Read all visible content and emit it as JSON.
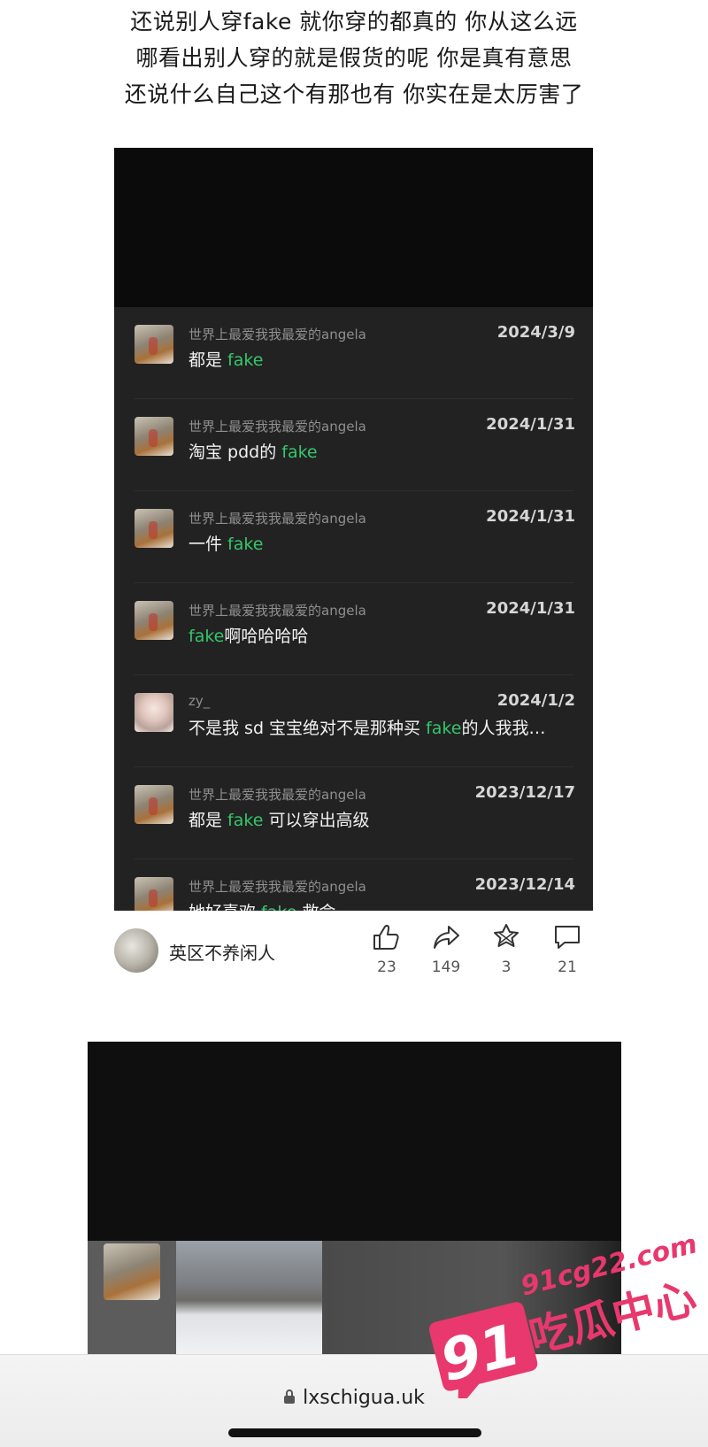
{
  "caption": {
    "lines": [
      "还说别人穿fake 就你穿的都真的 你从这么远",
      "哪看出别人穿的就是假货的呢 你是真有意思",
      "还说什么自己这个有那也有 你实在是太厉害了"
    ]
  },
  "comments": [
    {
      "name": "世界上最爱我我最爱的angela",
      "date": "2024/3/9",
      "pre": "都是 ",
      "hl": "fake",
      "post": ""
    },
    {
      "name": "世界上最爱我我最爱的angela",
      "date": "2024/1/31",
      "pre": "淘宝 pdd的 ",
      "hl": "fake",
      "post": ""
    },
    {
      "name": "世界上最爱我我最爱的angela",
      "date": "2024/1/31",
      "pre": "一件 ",
      "hl": "fake",
      "post": ""
    },
    {
      "name": "世界上最爱我我最爱的angela",
      "date": "2024/1/31",
      "pre": "",
      "hl": "fake",
      "post": "啊哈哈哈哈"
    },
    {
      "name": "zy_",
      "date": "2024/1/2",
      "pre": "不是我 sd 宝宝绝对不是那种买 ",
      "hl": "fake",
      "post": "的人我我…"
    },
    {
      "name": "世界上最爱我我最爱的angela",
      "date": "2023/12/17",
      "pre": "都是 ",
      "hl": "fake",
      "post": " 可以穿出高级"
    },
    {
      "name": "世界上最爱我我最爱的angela",
      "date": "2023/12/14",
      "pre": "她好喜欢 ",
      "hl": "fake",
      "post": " 救命"
    }
  ],
  "post_footer": {
    "author": "英区不养闲人",
    "likes": "23",
    "shares": "149",
    "stars": "3",
    "comments": "21"
  },
  "browser": {
    "url": "lxschigua.uk"
  },
  "watermark": {
    "domain": "91cg22.com",
    "number": "91",
    "brand": "吃瓜中心"
  },
  "colors": {
    "highlight": "#35c66b",
    "watermark": "#e8386d"
  }
}
